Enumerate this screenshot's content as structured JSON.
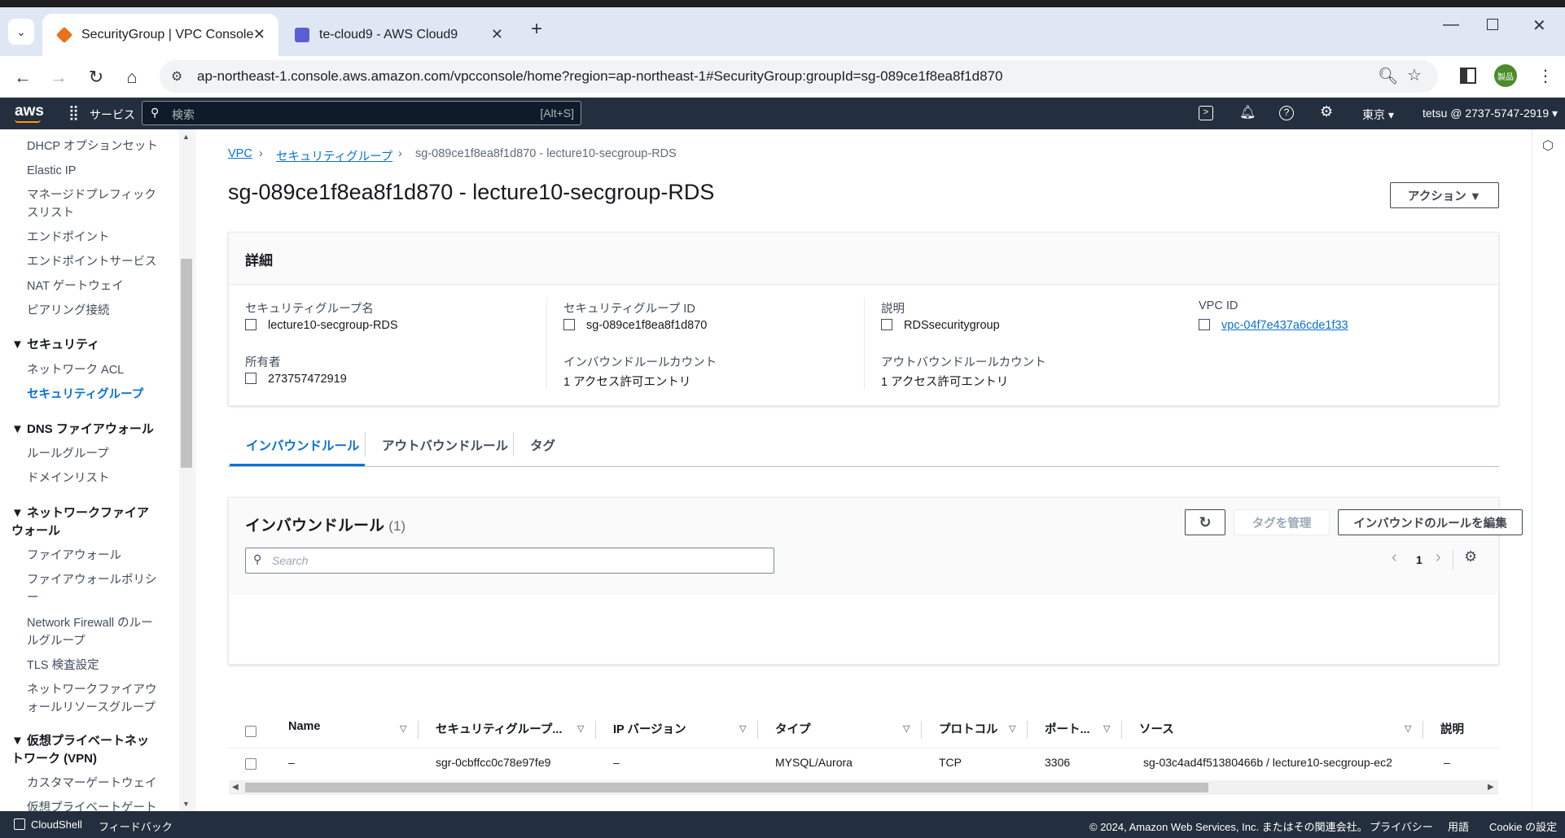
{
  "browser": {
    "tabs": [
      {
        "title": "SecurityGroup | VPC Console",
        "active": true
      },
      {
        "title": "te-cloud9 - AWS Cloud9",
        "active": false
      }
    ],
    "url": "ap-northeast-1.console.aws.amazon.com/vpcconsole/home?region=ap-northeast-1#SecurityGroup:groupId=sg-089ce1f8ea8f1d870",
    "profile_label": "製品"
  },
  "aws_nav": {
    "logo": "aws",
    "services_label": "サービス",
    "search_placeholder": "検索",
    "search_shortcut": "[Alt+S]",
    "region": "東京 ▾",
    "account": "tetsu @ 2737-5747-2919 ▾"
  },
  "sidebar": {
    "items": [
      {
        "label": "DHCP オプションセット"
      },
      {
        "label": "Elastic IP"
      },
      {
        "label": "マネージドプレフィックスリスト"
      },
      {
        "label": "エンドポイント"
      },
      {
        "label": "エンドポイントサービス"
      },
      {
        "label": "NAT ゲートウェイ"
      },
      {
        "label": "ピアリング接続"
      }
    ],
    "sec_security": "▼ セキュリティ",
    "sec_items": [
      "ネットワーク ACL",
      "セキュリティグループ"
    ],
    "sec_dns": "▼ DNS ファイアウォール",
    "dns_items": [
      "ルールグループ",
      "ドメインリスト"
    ],
    "sec_nfw": "▼ ネットワークファイアウォール",
    "nfw_items": [
      "ファイアウォール",
      "ファイアウォールポリシー",
      "Network Firewall のルールグループ",
      "TLS 検査設定",
      "ネットワークファイアウォールリソースグループ"
    ],
    "sec_vpn": "▼ 仮想プライベートネットワーク (VPN)",
    "vpn_items": [
      "カスタマーゲートウェイ",
      "仮想プライベートゲート"
    ]
  },
  "breadcrumb": {
    "vpc": "VPC",
    "sg": "セキュリティグループ",
    "current": "sg-089ce1f8ea8f1d870 - lecture10-secgroup-RDS"
  },
  "page": {
    "title": "sg-089ce1f8ea8f1d870 - lecture10-secgroup-RDS",
    "action_button": "アクション ▼"
  },
  "details": {
    "header": "詳細",
    "sg_name_label": "セキュリティグループ名",
    "sg_name": "lecture10-secgroup-RDS",
    "sg_id_label": "セキュリティグループ ID",
    "sg_id": "sg-089ce1f8ea8f1d870",
    "desc_label": "説明",
    "desc": "RDSsecuritygroup",
    "vpc_label": "VPC ID",
    "vpc": "vpc-04f7e437a6cde1f33",
    "owner_label": "所有者",
    "owner": "273757472919",
    "inbound_count_label": "インバウンドルールカウント",
    "inbound_count": "1 アクセス許可エントリ",
    "outbound_count_label": "アウトバウンドルールカウント",
    "outbound_count": "1 アクセス許可エントリ"
  },
  "tabs": [
    "インバウンドルール",
    "アウトバウンドルール",
    "タグ"
  ],
  "rules": {
    "title": "インバウンドルール",
    "count": "(1)",
    "manage_tags": "タグを管理",
    "edit": "インバウンドのルールを編集",
    "search_placeholder": "Search",
    "page": "1",
    "columns": [
      "Name",
      "セキュリティグループ...",
      "IP バージョン",
      "タイプ",
      "プロトコル",
      "ポート...",
      "ソース",
      "説明"
    ],
    "rows": [
      [
        "–",
        "sgr-0cbffcc0c78e97fe9",
        "–",
        "MYSQL/Aurora",
        "TCP",
        "3306",
        "sg-03c4ad4f51380466b / lecture10-secgroup-ec2",
        "–"
      ]
    ]
  },
  "footer": {
    "cloudshell": "CloudShell",
    "feedback": "フィードバック",
    "copyright": "© 2024, Amazon Web Services, Inc. またはその関連会社。",
    "privacy": "プライバシー",
    "terms": "用語",
    "cookie": "Cookie の設定"
  }
}
